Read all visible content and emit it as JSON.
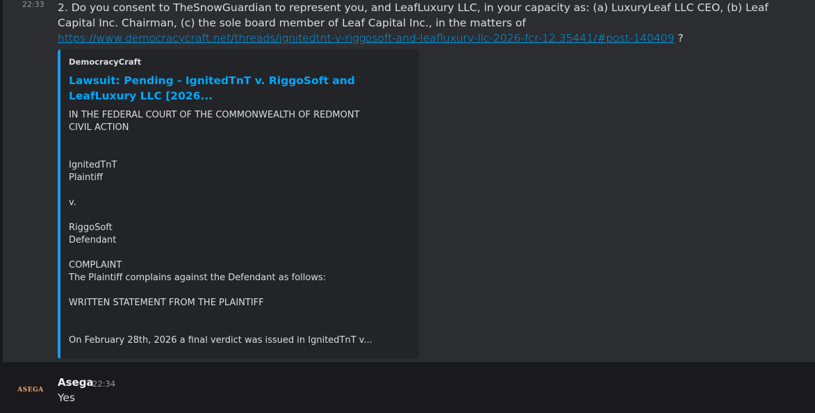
{
  "message1": {
    "timestamp": "22:33",
    "list_text_before_link": "2. Do you consent to TheSnowGuardian to represent you, and LeafLuxury LLC, in your capacity as: (a) LuxuryLeaf LLC CEO, (b) Leaf Capital Inc. Chairman, (c) the sole board member of Leaf Capital Inc., in the matters of ",
    "link_text": "https://www.democracycraft.net/threads/ignitedtnt-v-riggosoft-and-leafluxury-llc-2026-fcr-12.35441/#post-140409",
    "list_text_after_link": " ?",
    "embed": {
      "provider": "DemocracyCraft",
      "title": "Lawsuit: Pending - IgnitedTnT v. RiggoSoft and LeafLuxury LLC [2026...",
      "description": "IN THE FEDERAL COURT OF THE COMMONWEALTH OF REDMONT\nCIVIL ACTION\n\n\nIgnitedTnT\nPlaintiff\n\nv.\n\nRiggoSoft\nDefendant\n\nCOMPLAINT\nThe Plaintiff complains against the Defendant as follows:\n\nWRITTEN STATEMENT FROM THE PLAINTIFF\n\n\nOn February 28th, 2026 a final verdict was issued in IgnitedTnT v...",
      "accent_color": "#1e9be9"
    }
  },
  "message2": {
    "avatar_text": "ASEGA",
    "author": "Asega",
    "timestamp": "22:34",
    "content": "Yes"
  }
}
